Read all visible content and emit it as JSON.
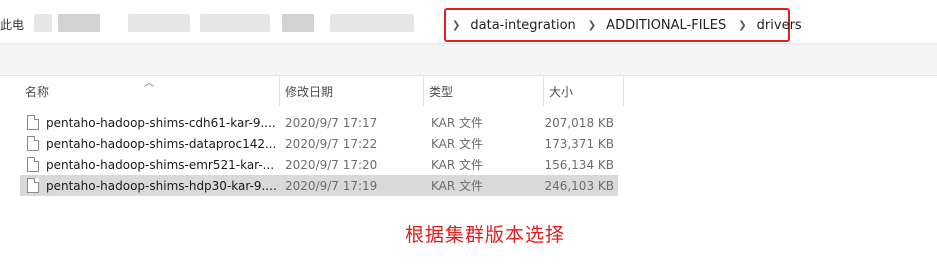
{
  "address_bar": {
    "left_label": "此电",
    "breadcrumbs": [
      "data-integration",
      "ADDITIONAL-FILES",
      "drivers"
    ]
  },
  "columns": {
    "name": "名称",
    "date": "修改日期",
    "type": "类型",
    "size": "大小"
  },
  "files": [
    {
      "name": "pentaho-hadoop-shims-cdh61-kar-9....",
      "date": "2020/9/7 17:17",
      "type": "KAR 文件",
      "size": "207,018 KB"
    },
    {
      "name": "pentaho-hadoop-shims-dataproc142...",
      "date": "2020/9/7 17:22",
      "type": "KAR 文件",
      "size": "173,371 KB"
    },
    {
      "name": "pentaho-hadoop-shims-emr521-kar-...",
      "date": "2020/9/7 17:20",
      "type": "KAR 文件",
      "size": "156,134 KB"
    },
    {
      "name": "pentaho-hadoop-shims-hdp30-kar-9....",
      "date": "2020/9/7 17:19",
      "type": "KAR 文件",
      "size": "246,103 KB"
    }
  ],
  "annotation": "根据集群版本选择",
  "colors": {
    "highlight": "#e02020",
    "selected_row": "#d9d9d9"
  }
}
